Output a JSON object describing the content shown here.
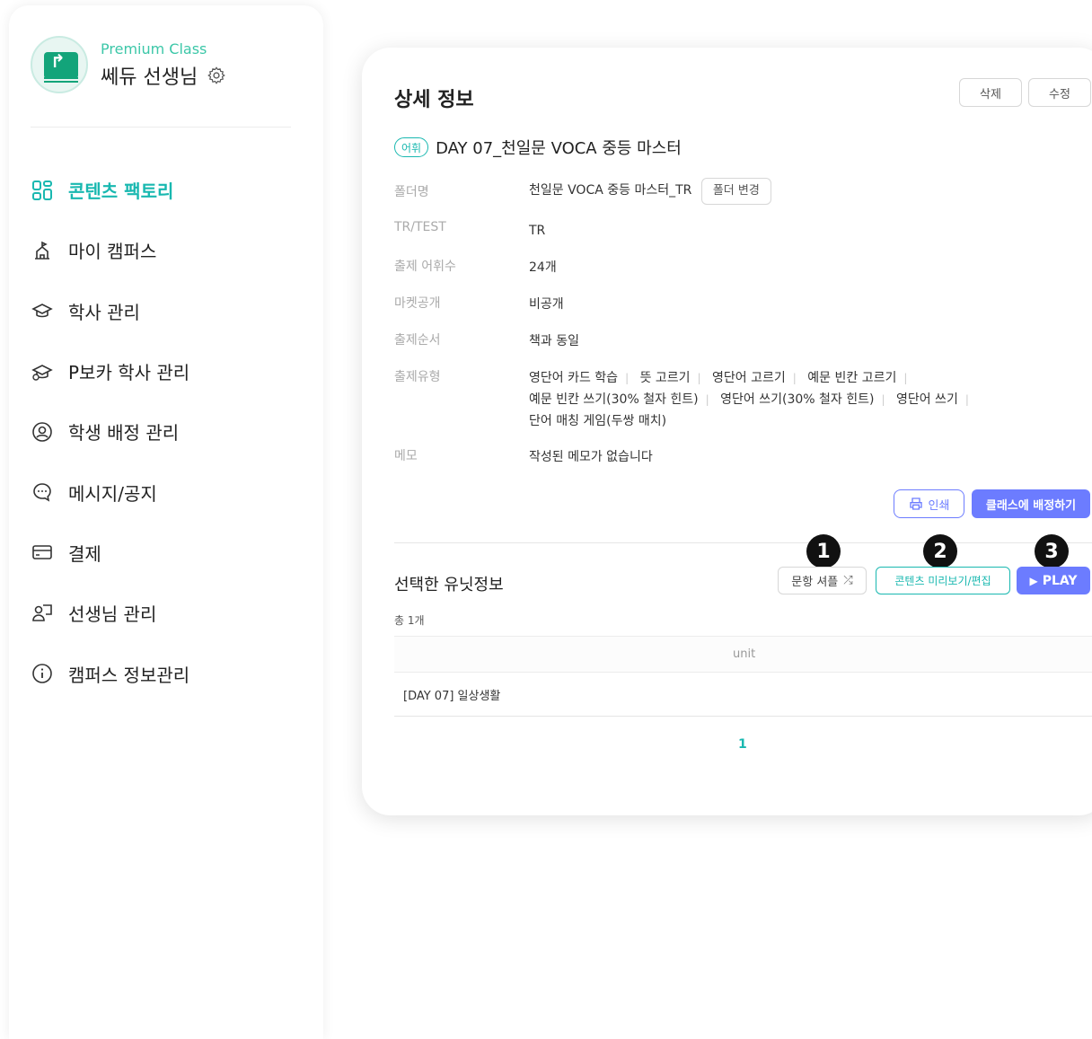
{
  "sidebar": {
    "premium_label": "Premium Class",
    "teacher_name": "쎄듀 선생님",
    "items": [
      {
        "label": "콘텐츠 팩토리",
        "icon": "grid-icon",
        "active": true
      },
      {
        "label": "마이 캠퍼스",
        "icon": "campus-icon",
        "active": false
      },
      {
        "label": "학사 관리",
        "icon": "graduation-cap-icon",
        "active": false
      },
      {
        "label": "P보카 학사 관리",
        "icon": "graduation-cap-p-icon",
        "active": false
      },
      {
        "label": "학생 배정 관리",
        "icon": "student-assign-icon",
        "active": false
      },
      {
        "label": "메시지/공지",
        "icon": "message-bubble-icon",
        "active": false
      },
      {
        "label": "결제",
        "icon": "card-icon",
        "active": false
      },
      {
        "label": "선생님 관리",
        "icon": "teacher-icon",
        "active": false
      },
      {
        "label": "캠퍼스 정보관리",
        "icon": "info-icon",
        "active": false
      }
    ]
  },
  "detail": {
    "title": "상세 정보",
    "delete_label": "삭제",
    "edit_label": "수정",
    "tag": "어휘",
    "content_title": "DAY 07_천일문 VOCA 중등 마스터",
    "rows": {
      "folder": {
        "label": "폴더명",
        "value": "천일문 VOCA 중등 마스터_TR",
        "button": "폴더 변경"
      },
      "trtest": {
        "label": "TR/TEST",
        "value": "TR"
      },
      "count": {
        "label": "출제 어휘수",
        "value": "24개"
      },
      "market": {
        "label": "마켓공개",
        "value": "비공개"
      },
      "order": {
        "label": "출제순서",
        "value": "책과 동일"
      },
      "types": {
        "label": "출제유형",
        "values": [
          "영단어 카드 학습",
          "뜻 고르기",
          "영단어 고르기",
          "예문 빈칸 고르기",
          "예문 빈칸 쓰기(30% 철자 힌트)",
          "영단어 쓰기(30% 철자 힌트)",
          "영단어 쓰기",
          "단어 매칭 게임(두쌍 매치)"
        ]
      },
      "memo": {
        "label": "메모",
        "value": "작성된 메모가 없습니다"
      }
    },
    "print_label": "인쇄",
    "assign_label": "클래스에 배정하기"
  },
  "unit_section": {
    "title": "선택한 유닛정보",
    "shuffle_label": "문항 셔플",
    "preview_label": "콘텐츠 미리보기/편집",
    "play_label": "PLAY",
    "markers": [
      "1",
      "2",
      "3"
    ],
    "total": "총 1개",
    "table": {
      "header": "unit",
      "rows": [
        "[DAY 07] 일상생활"
      ]
    },
    "page": "1"
  },
  "colors": {
    "accent_teal": "#19b8b0",
    "accent_purple": "#6c7cff",
    "brand_green": "#3cc7a8"
  }
}
